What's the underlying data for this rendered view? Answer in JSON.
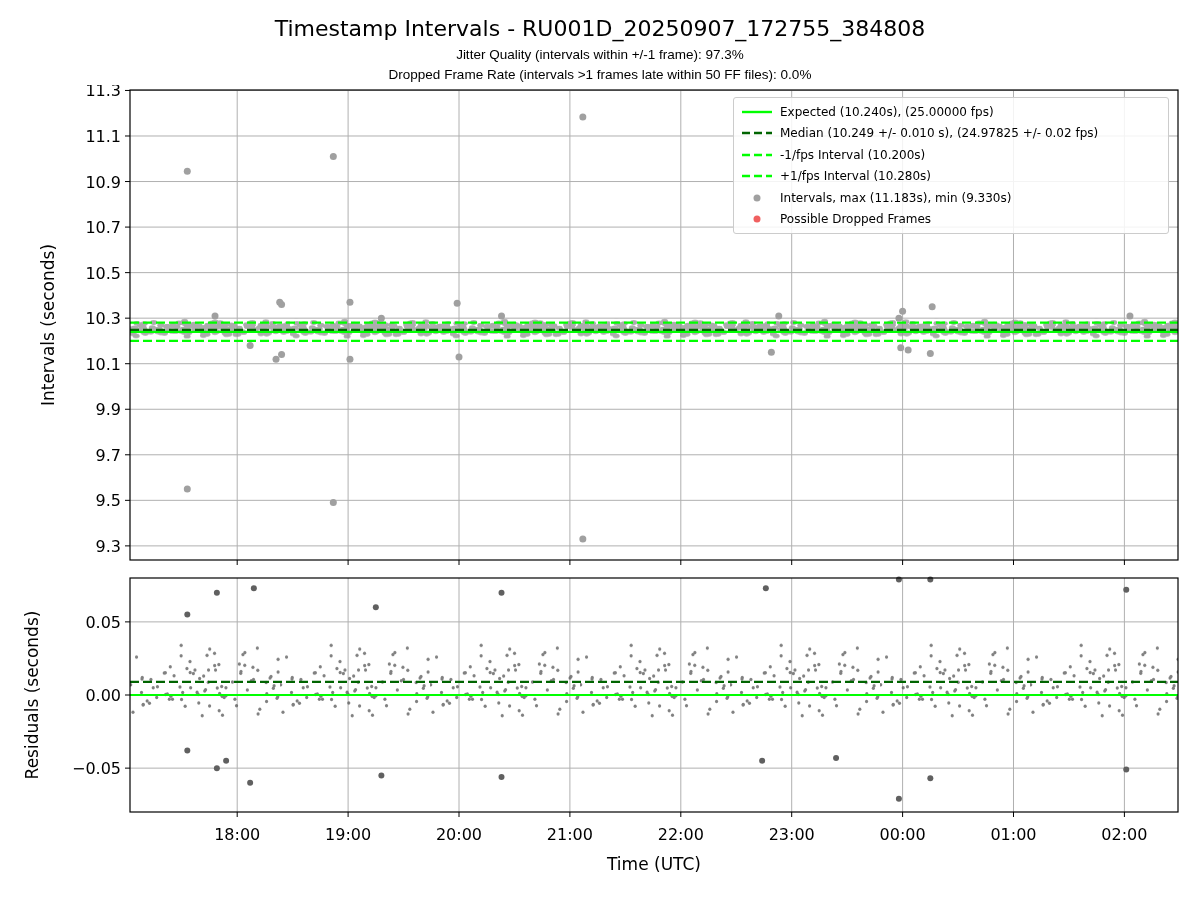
{
  "figure": {
    "title": "Timestamp Intervals - RU001D_20250907_172755_384808",
    "subtitles": [
      "Jitter Quality (intervals within +/-1 frame): 97.3%",
      "Dropped Frame Rate (intervals >1 frames late within 50 FF files): 0.0%"
    ]
  },
  "charts": [
    {
      "chart_data": {
        "type": "scatter",
        "ylabel": "Intervals (seconds)",
        "grid": true,
        "xlim": [
          "2025-09-07T17:02",
          "2025-09-08T02:29"
        ],
        "ylim": [
          9.238,
          11.302
        ],
        "yticks": [
          {
            "value": 9.3,
            "label": "9.3"
          },
          {
            "value": 9.5,
            "label": "9.5"
          },
          {
            "value": 9.7,
            "label": "9.7"
          },
          {
            "value": 9.9,
            "label": "9.9"
          },
          {
            "value": 10.1,
            "label": "10.1"
          },
          {
            "value": 10.3,
            "label": "10.3"
          },
          {
            "value": 10.5,
            "label": "10.5"
          },
          {
            "value": 10.7,
            "label": "10.7"
          },
          {
            "value": 10.9,
            "label": "10.9"
          },
          {
            "value": 11.1,
            "label": "11.1"
          },
          {
            "value": 11.3,
            "label": "11.3"
          }
        ],
        "x": [
          "2025-09-07T17:33",
          "2025-09-07T17:33",
          "2025-09-07T17:48",
          "2025-09-07T18:07",
          "2025-09-07T18:21",
          "2025-09-07T18:23",
          "2025-09-07T18:24",
          "2025-09-07T18:24",
          "2025-09-07T18:52",
          "2025-09-07T18:52",
          "2025-09-07T19:01",
          "2025-09-07T19:01",
          "2025-09-07T19:18",
          "2025-09-07T19:59",
          "2025-09-07T20:00",
          "2025-09-07T20:23",
          "2025-09-07T21:07",
          "2025-09-07T21:07",
          "2025-09-07T22:49",
          "2025-09-07T22:53",
          "2025-09-07T23:58",
          "2025-09-07T23:59",
          "2025-09-08T00:00",
          "2025-09-08T00:03",
          "2025-09-08T00:15",
          "2025-09-08T00:16",
          "2025-09-08T02:03"
        ],
        "series": [
          {
            "name": "Intervals, max (11.183s), min (9.330s)",
            "color": "#a0a0a0",
            "values": [
              10.945,
              9.55,
              10.31,
              10.18,
              10.12,
              10.37,
              10.36,
              10.14,
              11.01,
              9.49,
              10.37,
              10.12,
              10.3,
              10.365,
              10.13,
              10.31,
              11.183,
              9.33,
              10.15,
              10.31,
              10.3,
              10.17,
              10.33,
              10.16,
              10.145,
              10.35,
              10.31
            ]
          },
          {
            "name": "Possible Dropped Frames",
            "color": "#f06060",
            "values": [
              null,
              null,
              null,
              null,
              null,
              null,
              null,
              null,
              null,
              null,
              null,
              null,
              null,
              null,
              null,
              null,
              null,
              null,
              null,
              null,
              null,
              null,
              null,
              null,
              null,
              null,
              null
            ]
          }
        ],
        "ref_lines": [
          {
            "axis": "y",
            "value": 10.24,
            "label": "Expected (10.240s), (25.00000 fps)",
            "color": "#00ff00"
          },
          {
            "axis": "y",
            "value": 10.249,
            "label": "Median (10.249 +/- 0.010 s), (24.97825 +/- 0.02 fps)",
            "color": "#006400"
          },
          {
            "axis": "y",
            "value": 10.2,
            "label": "-1/fps Interval (10.200s)",
            "color": "#00ff00"
          },
          {
            "axis": "y",
            "value": 10.28,
            "label": "+1/fps Interval (10.280s)",
            "color": "#00ff00"
          }
        ],
        "bands": [
          {
            "axis": "y",
            "from": 10.21,
            "to": 10.3,
            "color": "#909090"
          }
        ]
      },
      "ref_line_styles": [
        {
          "dashed": false
        },
        {
          "dashed": true
        },
        {
          "dashed": true
        },
        {
          "dashed": true
        }
      ]
    },
    {
      "chart_data": {
        "type": "scatter",
        "xlabel": "Time (UTC)",
        "ylabel": "Residuals (seconds)",
        "grid": true,
        "xlim": [
          "2025-09-07T17:02",
          "2025-09-08T02:29"
        ],
        "ylim": [
          -0.08,
          0.08
        ],
        "xticks": [
          {
            "value": "2025-09-07T18:00",
            "label": "18:00"
          },
          {
            "value": "2025-09-07T19:00",
            "label": "19:00"
          },
          {
            "value": "2025-09-07T20:00",
            "label": "20:00"
          },
          {
            "value": "2025-09-07T21:00",
            "label": "21:00"
          },
          {
            "value": "2025-09-07T22:00",
            "label": "22:00"
          },
          {
            "value": "2025-09-07T23:00",
            "label": "23:00"
          },
          {
            "value": "2025-09-08T00:00",
            "label": "00:00"
          },
          {
            "value": "2025-09-08T01:00",
            "label": "01:00"
          },
          {
            "value": "2025-09-08T02:00",
            "label": "02:00"
          }
        ],
        "yticks": [
          {
            "value": -0.05,
            "label": "−0.05"
          },
          {
            "value": 0,
            "label": "0.00"
          },
          {
            "value": 0.05,
            "label": "0.05"
          }
        ],
        "x": [
          "2025-09-07T17:33",
          "2025-09-07T17:33",
          "2025-09-07T17:49",
          "2025-09-07T17:49",
          "2025-09-07T17:54",
          "2025-09-07T18:07",
          "2025-09-07T18:09",
          "2025-09-07T19:15",
          "2025-09-07T19:18",
          "2025-09-07T20:23",
          "2025-09-07T20:23",
          "2025-09-07T22:44",
          "2025-09-07T22:46",
          "2025-09-07T23:24",
          "2025-09-07T23:58",
          "2025-09-07T23:58",
          "2025-09-08T00:15",
          "2025-09-08T00:15",
          "2025-09-08T02:01",
          "2025-09-08T02:01"
        ],
        "series": [
          {
            "color": "#606060",
            "values": [
              0.055,
              -0.038,
              0.07,
              -0.05,
              -0.045,
              -0.06,
              0.073,
              0.06,
              -0.055,
              0.07,
              -0.056,
              -0.045,
              0.073,
              -0.043,
              0.079,
              -0.071,
              0.079,
              -0.057,
              0.072,
              -0.051
            ]
          }
        ],
        "ref_lines": [
          {
            "axis": "y",
            "value": 0,
            "color": "#00ff00"
          },
          {
            "axis": "y",
            "value": 0.009,
            "color": "#006400"
          }
        ],
        "bands": [
          {
            "axis": "y",
            "from": -0.03,
            "to": 0.045,
            "color": "#555555"
          }
        ]
      }
    }
  ]
}
